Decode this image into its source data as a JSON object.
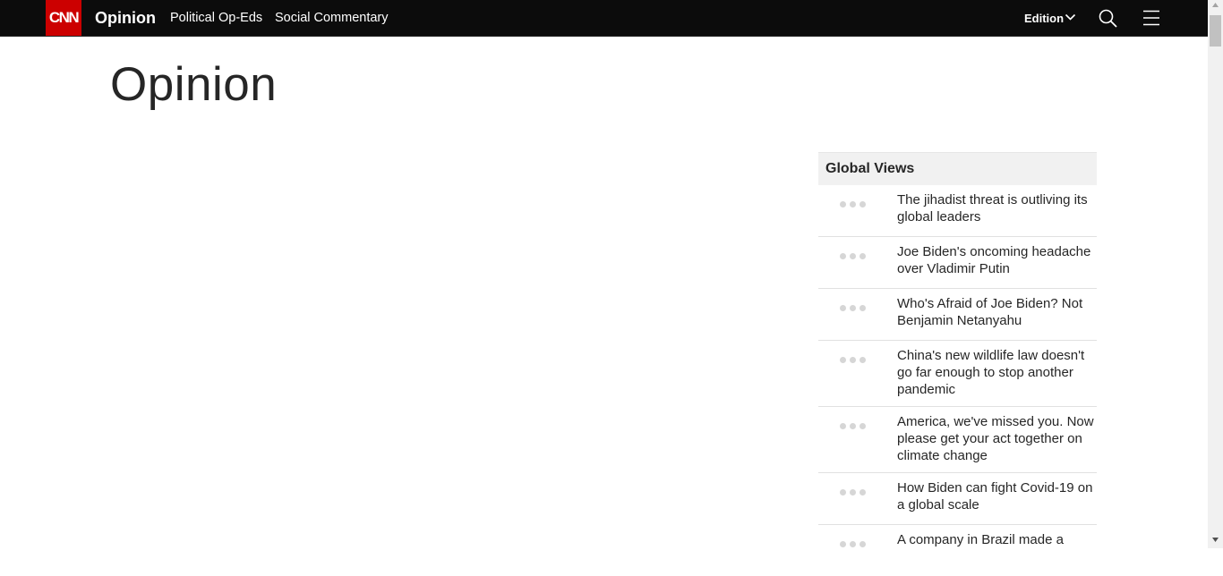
{
  "header": {
    "logo_text": "CNN",
    "section_name": "Opinion",
    "nav_links": [
      {
        "label": "Political Op-Eds"
      },
      {
        "label": "Social Commentary"
      }
    ],
    "edition_label": "Edition",
    "icons": [
      "chevron-down-icon",
      "search-icon",
      "hamburger-menu-icon"
    ],
    "colors": {
      "bar": "#0c0c0c",
      "brand": "#cc0000"
    }
  },
  "main": {
    "page_title": "Opinion"
  },
  "rail": {
    "heading": "Global Views",
    "items": [
      {
        "title": "The jihadist threat is outliving its global leaders"
      },
      {
        "title": "Joe Biden's oncoming headache over Vladimir Putin"
      },
      {
        "title": "Who's Afraid of Joe Biden? Not Benjamin Netanyahu"
      },
      {
        "title": "China's new wildlife law doesn't go far enough to stop another pandemic"
      },
      {
        "title": "America, we've missed you. Now please get your act together on climate change"
      },
      {
        "title": "How Biden can fight Covid-19 on a global scale"
      },
      {
        "title": "A company in Brazil made a"
      }
    ]
  }
}
